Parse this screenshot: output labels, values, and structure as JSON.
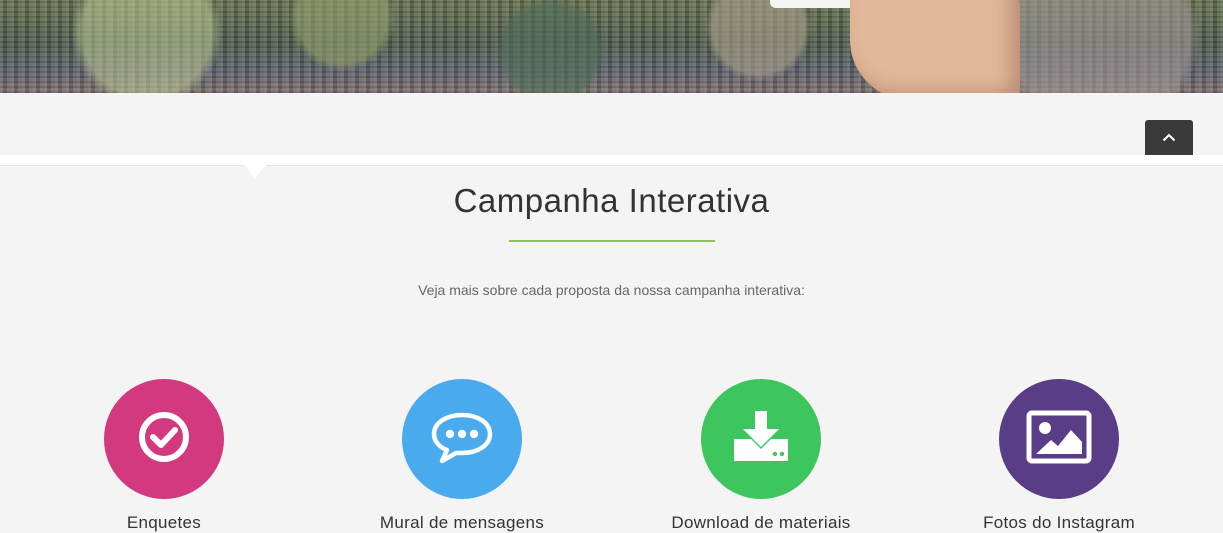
{
  "section": {
    "title": "Campanha Interativa",
    "subtitle": "Veja mais sobre cada proposta da nossa campanha interativa:"
  },
  "features": [
    {
      "label": "Enquetes",
      "icon": "check-circle-icon",
      "color": "#d2397f"
    },
    {
      "label": "Mural de mensagens",
      "icon": "chat-bubble-icon",
      "color": "#49aaee"
    },
    {
      "label": "Download de materiais",
      "icon": "download-icon",
      "color": "#3ec65e"
    },
    {
      "label": "Fotos do Instagram",
      "icon": "image-icon",
      "color": "#5a3d87"
    }
  ],
  "colors": {
    "accent_divider": "#8dc15a",
    "scroll_top_button": "#3a3a3a",
    "background": "#f4f4f4"
  },
  "scroll_top": {
    "icon": "chevron-up-icon"
  }
}
